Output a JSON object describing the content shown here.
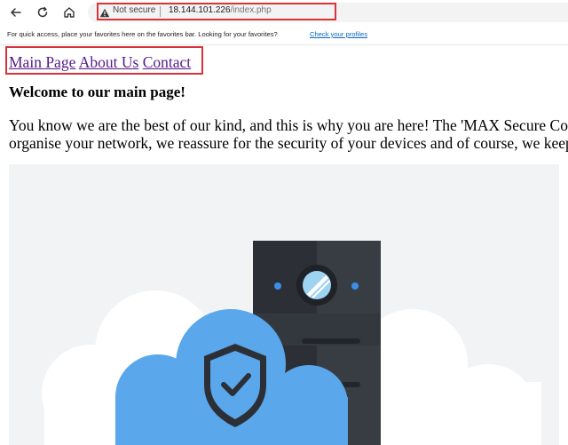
{
  "browser": {
    "security_label": "Not secure",
    "url_host": "18.144.101.226",
    "url_path": "/index.php",
    "icons": [
      "back-arrow-icon",
      "refresh-icon",
      "home-icon",
      "warning-triangle-icon"
    ]
  },
  "favorites_bar": {
    "message": "For quick access, place your favorites here on the favorites bar. Looking for your favorites?",
    "link": "Check your profiles"
  },
  "site_nav": {
    "items": [
      "Main Page",
      "About Us",
      "Contact"
    ]
  },
  "main": {
    "heading": "Welcome to our main page!",
    "paragraph_line1": "You know we are the best of our kind, and this is why you are here! The 'MAX Secure Compan",
    "paragraph_line2": "organise your network, we reassure for the security of your devices and of course, we keep hacl"
  },
  "colors": {
    "highlight_border": "#d6333a",
    "link_visited": "#551a8b",
    "cloud_blue": "#5aa7ec",
    "server_dark": "#2c3036",
    "hero_background": "#f1f3f5"
  }
}
